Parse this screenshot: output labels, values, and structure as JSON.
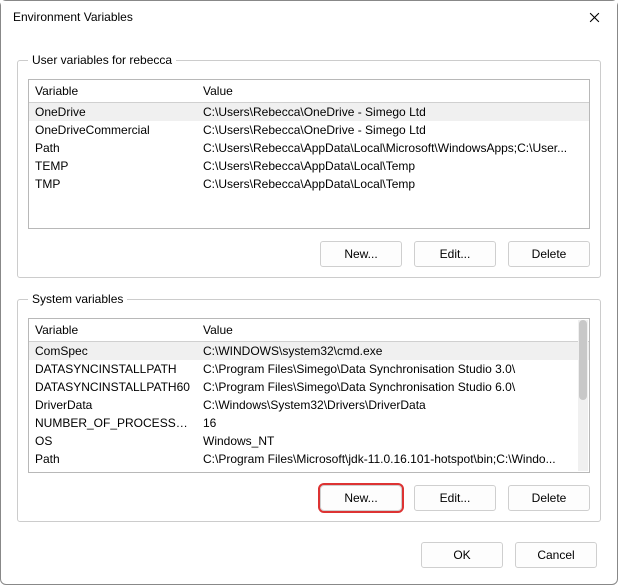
{
  "window": {
    "title": "Environment Variables"
  },
  "userSection": {
    "legend": "User variables for rebecca",
    "columns": {
      "var": "Variable",
      "val": "Value"
    },
    "rows": [
      {
        "var": "OneDrive",
        "val": "C:\\Users\\Rebecca\\OneDrive - Simego Ltd",
        "selected": true
      },
      {
        "var": "OneDriveCommercial",
        "val": "C:\\Users\\Rebecca\\OneDrive - Simego Ltd"
      },
      {
        "var": "Path",
        "val": "C:\\Users\\Rebecca\\AppData\\Local\\Microsoft\\WindowsApps;C:\\User..."
      },
      {
        "var": "TEMP",
        "val": "C:\\Users\\Rebecca\\AppData\\Local\\Temp"
      },
      {
        "var": "TMP",
        "val": "C:\\Users\\Rebecca\\AppData\\Local\\Temp"
      }
    ],
    "buttons": {
      "new": "New...",
      "edit": "Edit...",
      "del": "Delete"
    }
  },
  "sysSection": {
    "legend": "System variables",
    "columns": {
      "var": "Variable",
      "val": "Value"
    },
    "rows": [
      {
        "var": "ComSpec",
        "val": "C:\\WINDOWS\\system32\\cmd.exe",
        "selected": true
      },
      {
        "var": "DATASYNCINSTALLPATH",
        "val": "C:\\Program Files\\Simego\\Data Synchronisation Studio 3.0\\"
      },
      {
        "var": "DATASYNCINSTALLPATH60",
        "val": "C:\\Program Files\\Simego\\Data Synchronisation Studio 6.0\\"
      },
      {
        "var": "DriverData",
        "val": "C:\\Windows\\System32\\Drivers\\DriverData"
      },
      {
        "var": "NUMBER_OF_PROCESSORS",
        "val": "16"
      },
      {
        "var": "OS",
        "val": "Windows_NT"
      },
      {
        "var": "Path",
        "val": "C:\\Program Files\\Microsoft\\jdk-11.0.16.101-hotspot\\bin;C:\\Windo..."
      }
    ],
    "buttons": {
      "new": "New...",
      "edit": "Edit...",
      "del": "Delete"
    }
  },
  "dialogButtons": {
    "ok": "OK",
    "cancel": "Cancel"
  }
}
